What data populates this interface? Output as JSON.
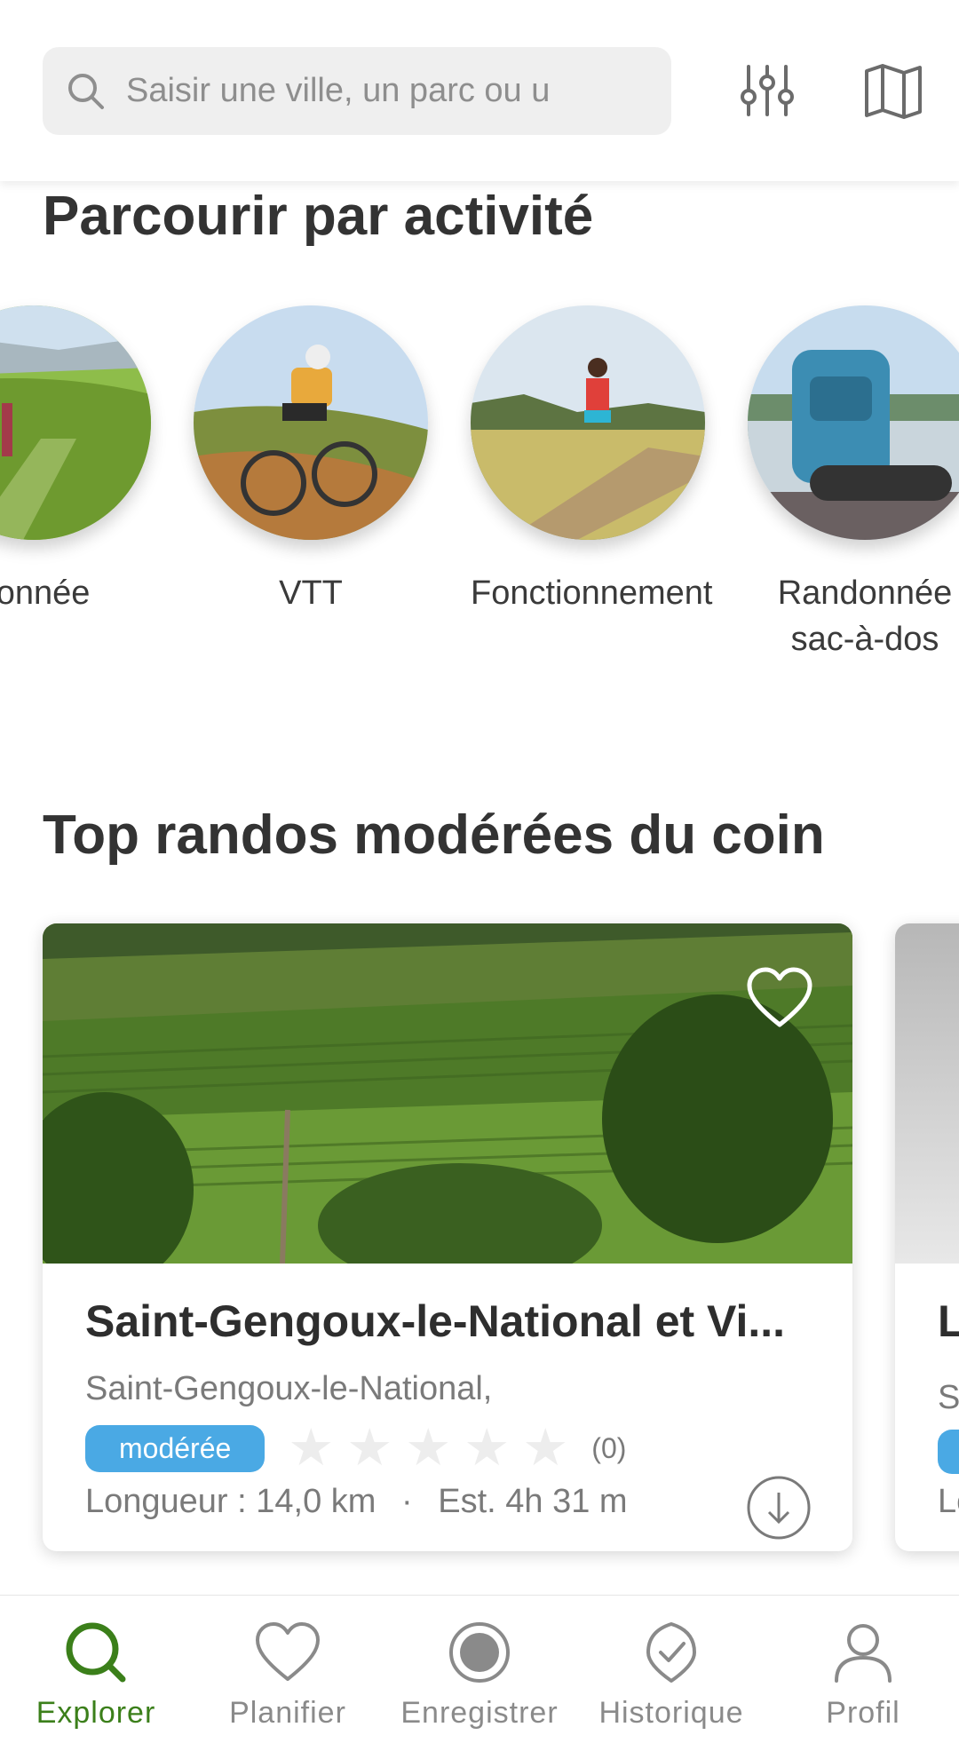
{
  "search": {
    "placeholder": "Saisir une ville, un parc ou u"
  },
  "sections": {
    "activity_title": "Parcourir par activité",
    "top_title": "Top randos modérées du coin"
  },
  "activities": [
    {
      "label": "donnée"
    },
    {
      "label": "VTT"
    },
    {
      "label": "Fonctionnement"
    },
    {
      "label": "Randonnée sac-à-dos"
    }
  ],
  "card": {
    "title": "Saint-Gengoux-le-National et Vi...",
    "location": "Saint-Gengoux-le-National,",
    "difficulty": "modérée",
    "rating_count": "(0)",
    "length": "Longueur : 14,0 km",
    "separator": "·",
    "duration": "Est. 4h 31 m"
  },
  "card2": {
    "title_partial": "L",
    "location_partial": "S",
    "meta_partial": "Lo"
  },
  "nav": {
    "items": [
      {
        "label": "Explorer"
      },
      {
        "label": "Planifier"
      },
      {
        "label": "Enregistrer"
      },
      {
        "label": "Historique"
      },
      {
        "label": "Profil"
      }
    ]
  },
  "colors": {
    "accent": "#3b7f1a",
    "badge": "#4aa9e4",
    "icon": "#6b6b6b"
  }
}
